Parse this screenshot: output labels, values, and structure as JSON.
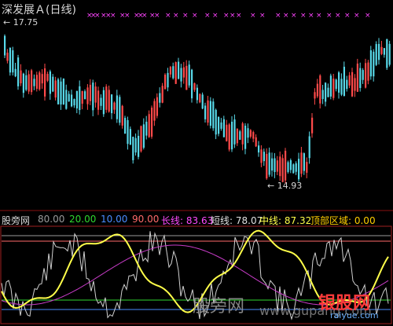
{
  "title": "深发展Ａ(日线)",
  "price_high_label": "17.75",
  "price_low_label": "14.93",
  "indicator": {
    "name": "股旁网",
    "items": [
      {
        "text": "80.00",
        "color": "#9a9a9a"
      },
      {
        "text": "20.00",
        "color": "#2fd82f"
      },
      {
        "text": "10.00",
        "color": "#4a8cff"
      },
      {
        "text": "90.00",
        "color": "#ff6a6a"
      },
      {
        "text": "长线: 83.63",
        "color": "#ff4aff"
      },
      {
        "text": "短线: 78.07",
        "color": "#e0e0e0"
      },
      {
        "text": "中线: 87.32",
        "color": "#ffff4a"
      },
      {
        "text": "顶部区域: 0.00",
        "color": "#ffcf00"
      }
    ]
  },
  "watermarks": {
    "w1": "股旁网",
    "w2": "www.gupang.com",
    "w3": "银股网",
    "w4": "raiyue.com"
  },
  "colors": {
    "up": "#ff4a4a",
    "down": "#58d8e8",
    "markers": "#ff44ff",
    "panel_border": "#a02020"
  }
}
